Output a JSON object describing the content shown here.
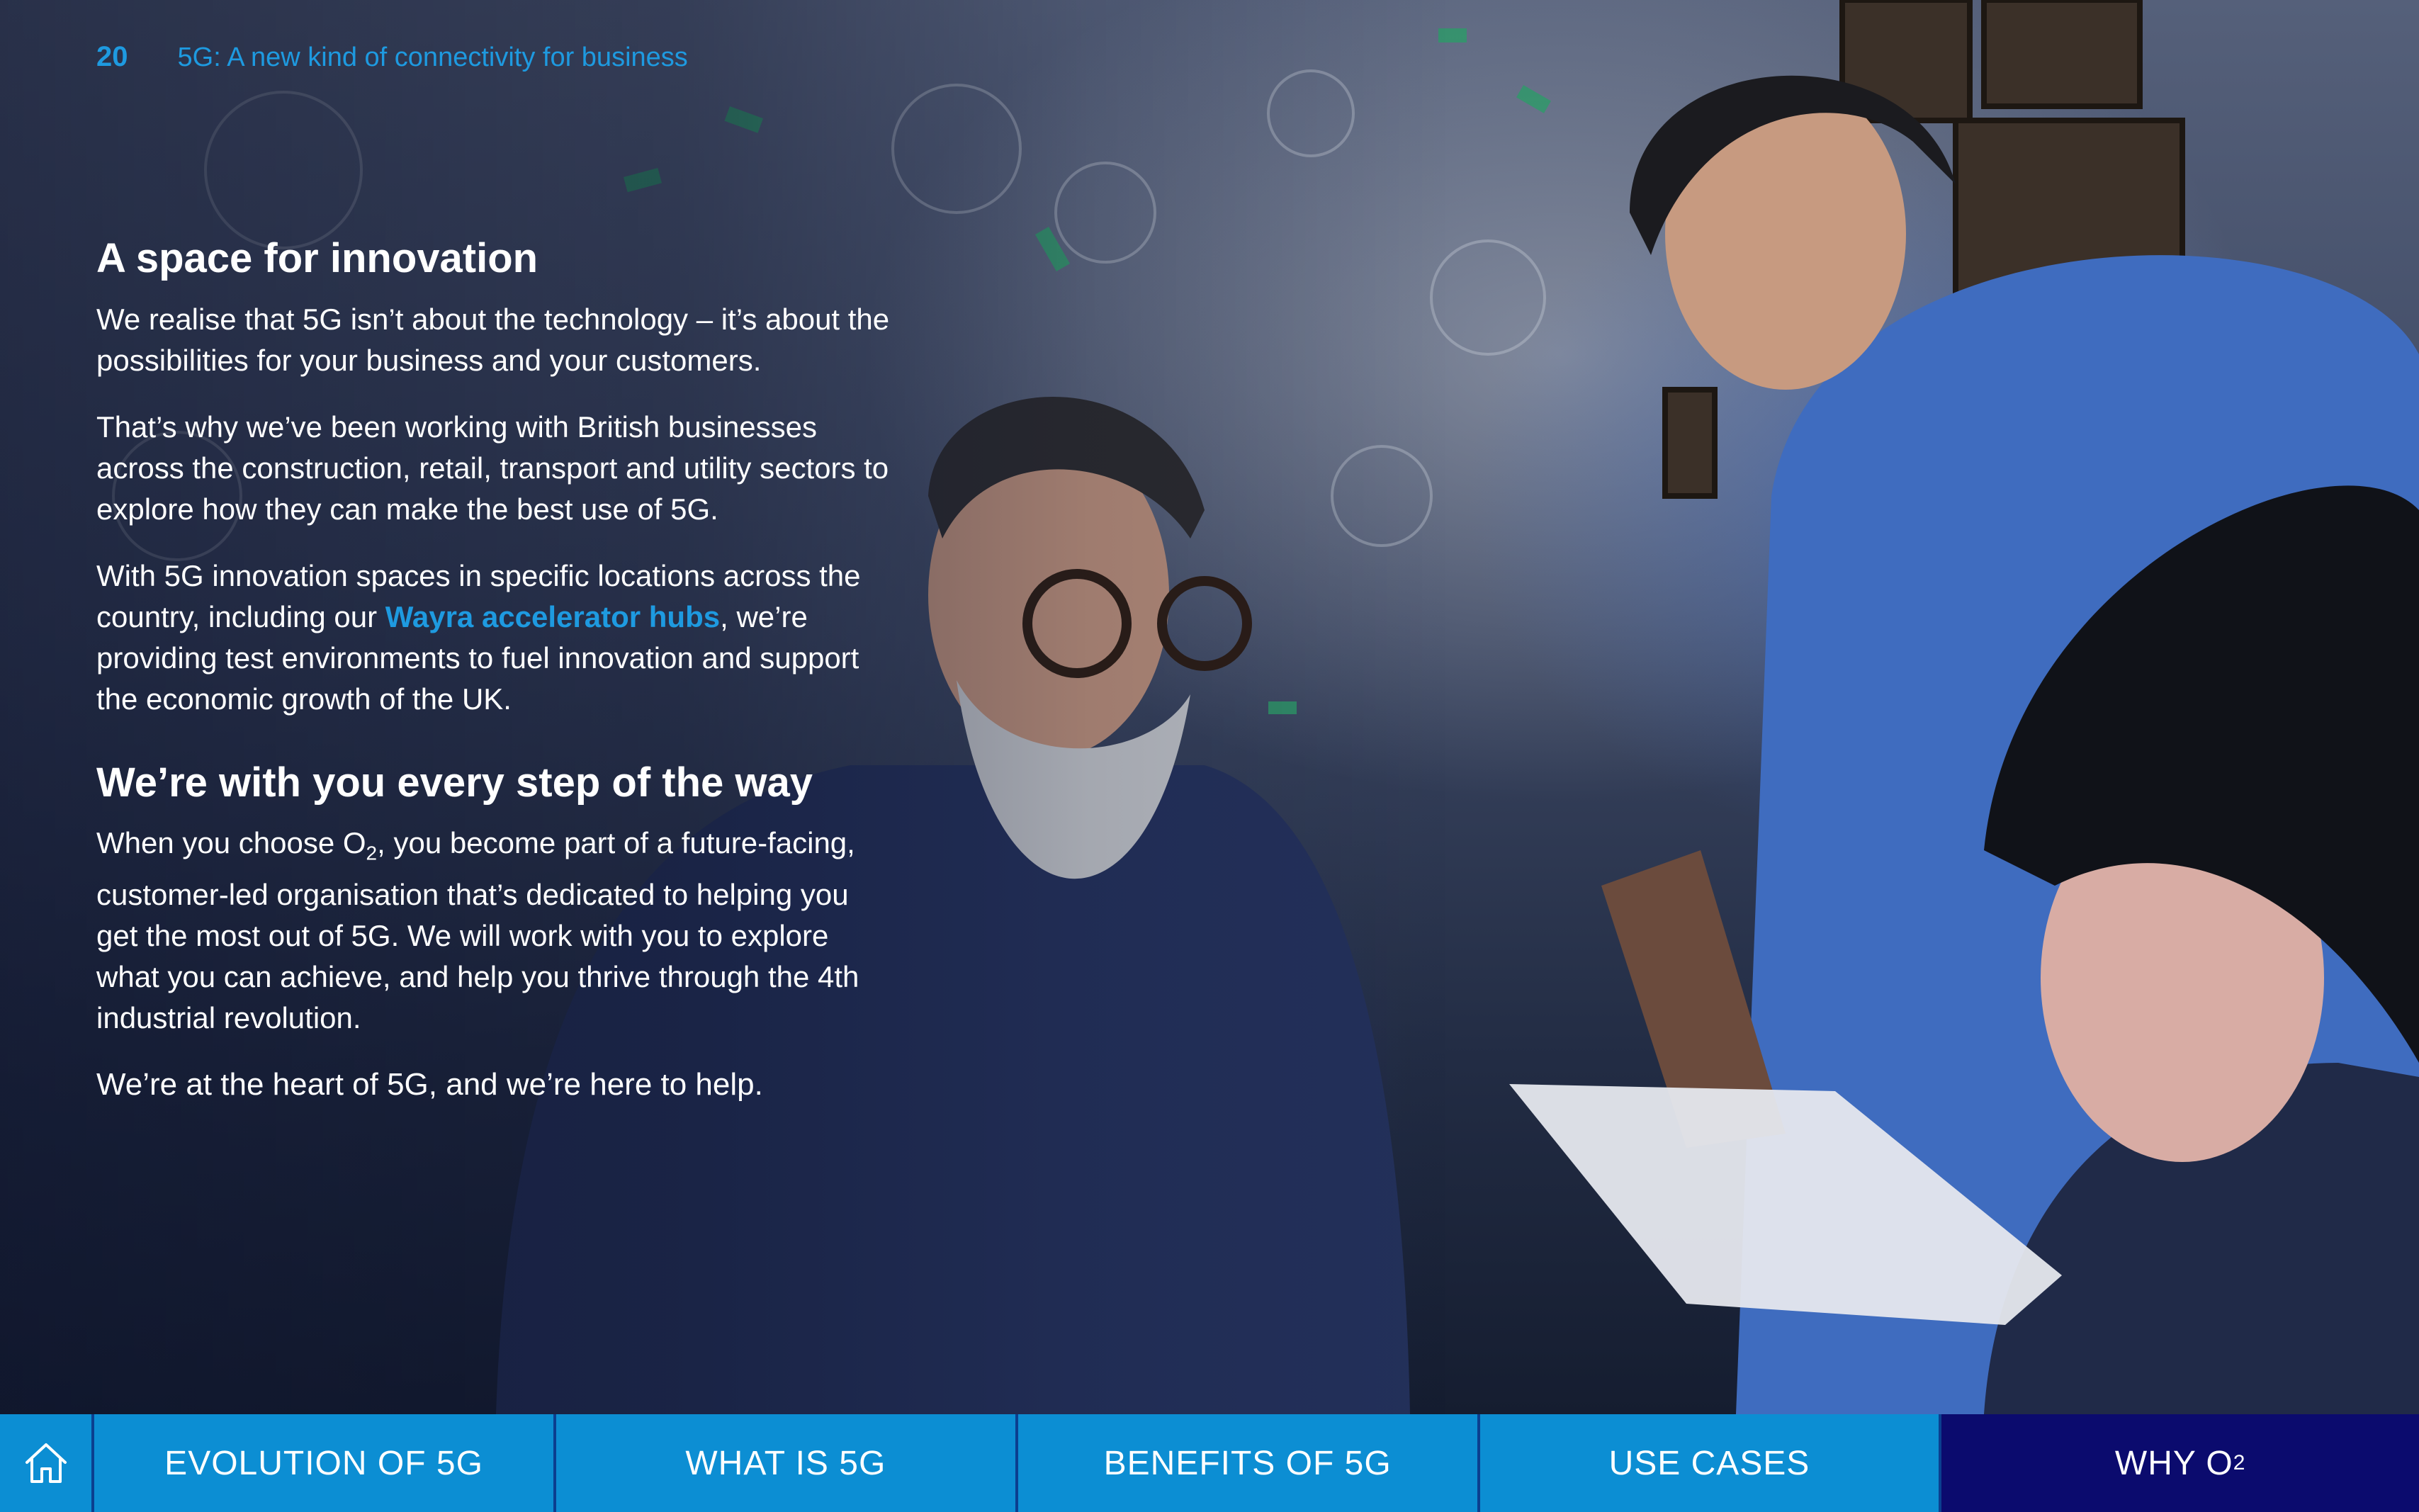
{
  "header": {
    "page_number": "20",
    "doc_title": "5G: A new kind of connectivity for business"
  },
  "section1": {
    "heading": "A space for innovation",
    "p1": "We realise that 5G isn’t about the technology – it’s about the possibilities for your business and your customers.",
    "p2": "That’s why we’ve been working with British businesses across the construction, retail, transport and utility sectors to explore how they can make the best use of 5G.",
    "p3_before": "With 5G innovation spaces in specific locations across the country, including our ",
    "p3_link": "Wayra accelerator hubs",
    "p3_after": ", we’re providing test environments to fuel innovation and support the economic growth of the UK."
  },
  "section2": {
    "heading": "We’re with you every step of the way",
    "p1_before": "When you choose O",
    "p1_sub": "2",
    "p1_after": ", you become part of a future-facing, customer-led organisation that’s dedicated to helping you get the most out of 5G. We will work with you to explore what you can achieve, and help you thrive through the 4th industrial revolution.",
    "closing": "We’re at the heart of 5G, and we’re here to help."
  },
  "nav": {
    "home_icon": "home-icon",
    "tabs": [
      {
        "label": "EVOLUTION OF 5G"
      },
      {
        "label": "WHAT IS 5G"
      },
      {
        "label": "BENEFITS OF 5G"
      },
      {
        "label": "USE CASES"
      },
      {
        "label": "WHY O",
        "sub": "2",
        "active": true
      }
    ]
  },
  "colors": {
    "accent": "#1e9ae0",
    "nav_bg": "#0c8ed3",
    "nav_active": "#0b0b6e"
  }
}
